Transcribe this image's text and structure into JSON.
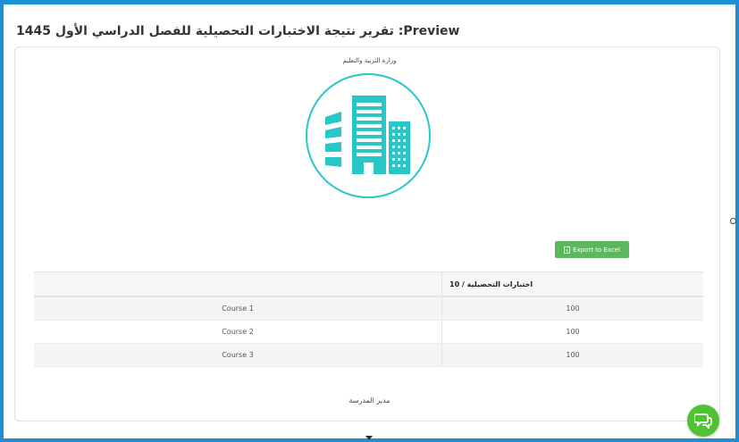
{
  "header": {
    "title": "تقرير نتيجة الاختبارات التحصيلية للفصل الدراسي الأول 1445 :Preview"
  },
  "report": {
    "ministry": "وزارة التربية والتعليم",
    "logo_icon": "buildings-icon",
    "export_button": "Export to Excel",
    "table": {
      "headers": [
        "",
        "اختبارات التحصيلية / 10"
      ],
      "rows": [
        {
          "course": "Course 1",
          "score": "100"
        },
        {
          "course": "Course 2",
          "score": "100"
        },
        {
          "course": "Course 3",
          "score": "100"
        }
      ]
    },
    "footer": "مدير المدرسة"
  },
  "colors": {
    "frame": "#1e8fd6",
    "logo": "#27c7c8",
    "export_button": "#5cb85c",
    "chat_button": "#51c234"
  },
  "icons": {
    "chat": "chat-bubbles-icon",
    "excel": "excel-file-icon"
  }
}
